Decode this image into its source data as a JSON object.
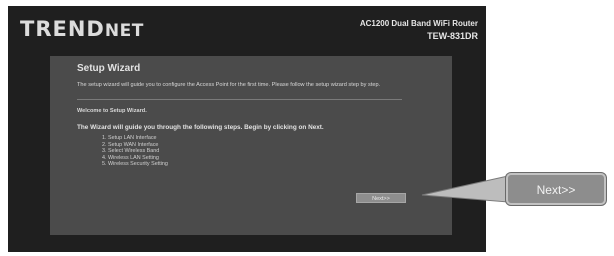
{
  "header": {
    "brand_main": "TREND",
    "brand_sub": "NET",
    "product_line": "AC1200 Dual Band WiFi Router",
    "model": "TEW-831DR"
  },
  "wizard": {
    "title": "Setup Wizard",
    "intro": "The setup wizard will guide you to configure the Access Point for the first time. Please follow the setup wizard step by step.",
    "welcome": "Welcome to Setup Wizard.",
    "guide": "The Wizard will guide you through the following steps. Begin by clicking on Next.",
    "steps": [
      "1. Setup LAN Interface",
      "2. Setup WAN Interface",
      "3. Select Wireless Band",
      "4. Wireless LAN Setting",
      "5. Wireless Security Setting"
    ],
    "next_label": "Next>>"
  },
  "callout": {
    "next_label": "Next>>"
  }
}
